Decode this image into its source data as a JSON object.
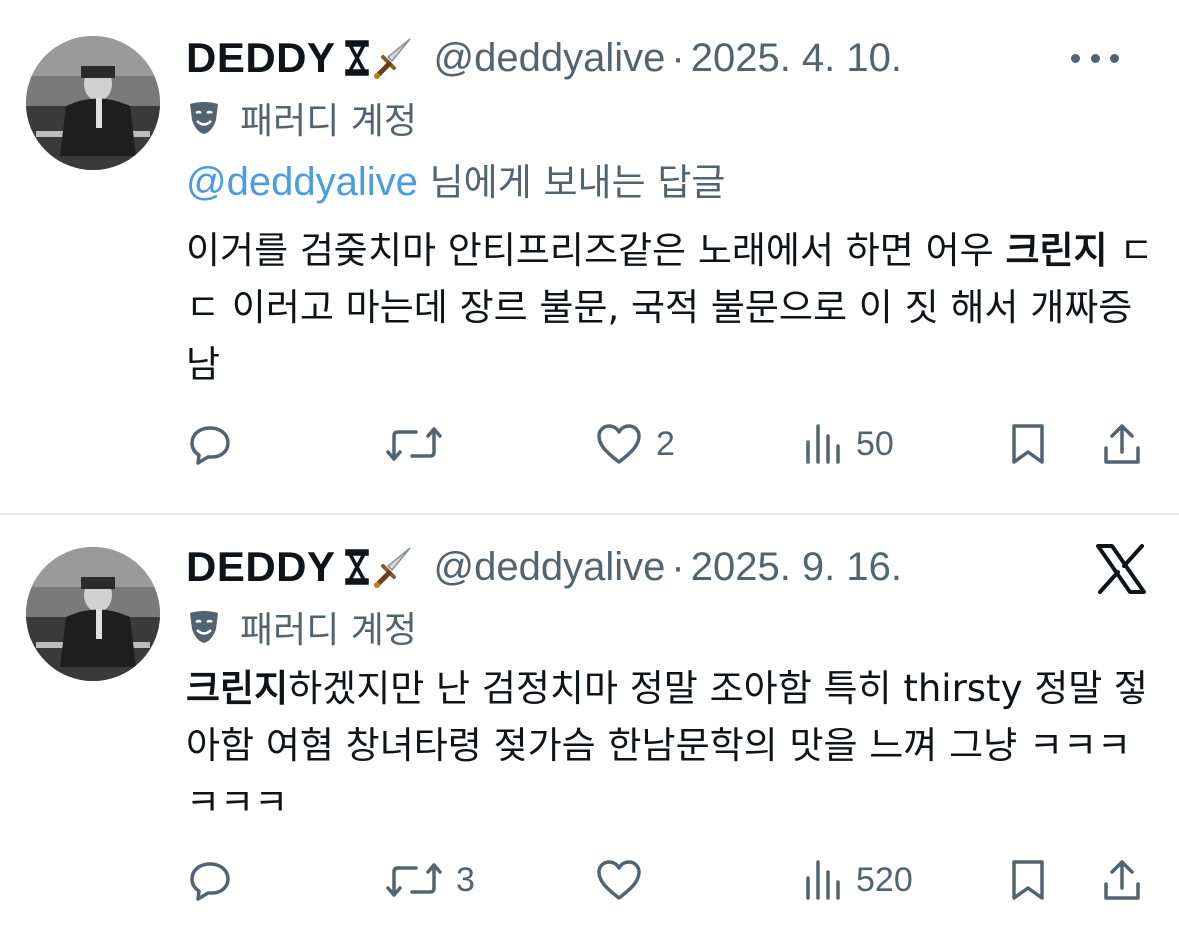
{
  "tweets": [
    {
      "author_name": "DEDDY",
      "handle": "@deddyalive",
      "separator": "·",
      "date": "2025. 4. 10.",
      "parody_label": "패러디 계정",
      "reply_prefix": "@deddyalive",
      "reply_suffix": " 님에게 보내는 답글",
      "text_parts": [
        "이거를 검줒치마 안티프리즈같은 노래에서 하면 어우 ",
        "크린지",
        " ㄷㄷ 이러고 마는데 장르 불문, 국적 불문으로 이 짓 해서 개짜증남"
      ],
      "actions": {
        "reply": "",
        "retweet": "",
        "like": "2",
        "views": "50",
        "bookmark": "",
        "share": ""
      },
      "top_right": "more-icon"
    },
    {
      "author_name": "DEDDY",
      "handle": "@deddyalive",
      "separator": "·",
      "date": "2025. 9. 16.",
      "parody_label": "패러디 계정",
      "text_parts": [
        "크린지",
        "하겠지만 난 검정치마 정말 조아함 특히 thirsty 정말 젛아함 여혐 창녀타령 젖가슴 한남문학의 맛을 느껴 그냥 ㅋㅋㅋㅋㅋㅋ"
      ],
      "actions": {
        "reply": "",
        "retweet": "3",
        "like": "",
        "views": "520",
        "bookmark": "",
        "share": ""
      },
      "top_right": "x-logo"
    }
  ],
  "colors": {
    "text": "#0f1419",
    "muted": "#536471",
    "mention": "#4a9de0",
    "divider": "#e6e9eb"
  }
}
